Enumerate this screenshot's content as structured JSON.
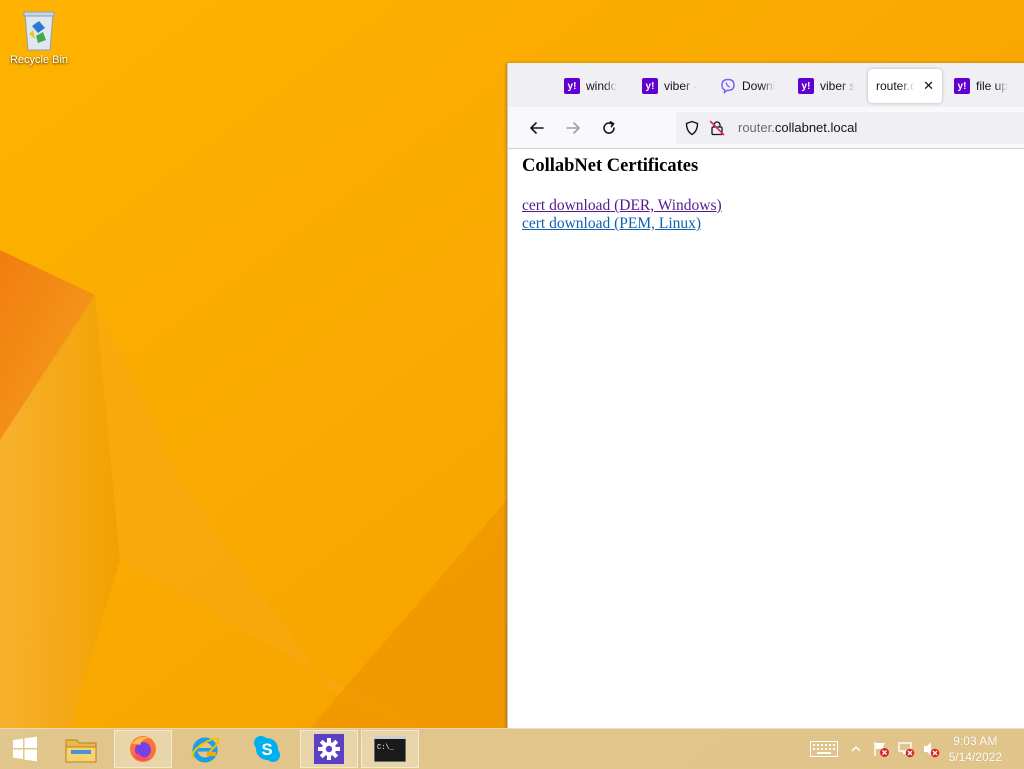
{
  "desktop": {
    "recycle_bin_label": "Recycle Bin"
  },
  "browser": {
    "tabs": [
      {
        "label": "windo",
        "favicon": "yahoo-icon",
        "active": false
      },
      {
        "label": "viber -",
        "favicon": "yahoo-icon",
        "active": false
      },
      {
        "label": "Downl",
        "favicon": "viber-icon",
        "active": false
      },
      {
        "label": "viber s",
        "favicon": "yahoo-icon",
        "active": false
      },
      {
        "label": "router.co",
        "favicon": "none",
        "active": true
      },
      {
        "label": "file up",
        "favicon": "yahoo-icon",
        "active": false
      }
    ],
    "favicon_text": "y!",
    "close_glyph": "✕",
    "url_host_prefix": "router.",
    "url_host_rest": "collabnet.local",
    "page": {
      "heading": "CollabNet Certificates",
      "links": [
        {
          "text": "cert download (DER, Windows)",
          "state": "visited"
        },
        {
          "text": "cert download (PEM, Linux)",
          "state": "unvisited"
        }
      ]
    }
  },
  "taskbar": {
    "apps": [
      "windows-start-icon",
      "file-explorer-icon",
      "firefox-icon",
      "internet-explorer-icon",
      "skype-icon",
      "settings-icon",
      "command-prompt-icon"
    ],
    "cmd_prompt_text": "C:\\_",
    "clock_time": "9:03 AM",
    "clock_date": "5/14/2022"
  },
  "colors": {
    "wallpaper": "#f6a800",
    "yahoo_purple": "#6001d2",
    "visited_link": "#551a8b",
    "link": "#0e62ad"
  }
}
